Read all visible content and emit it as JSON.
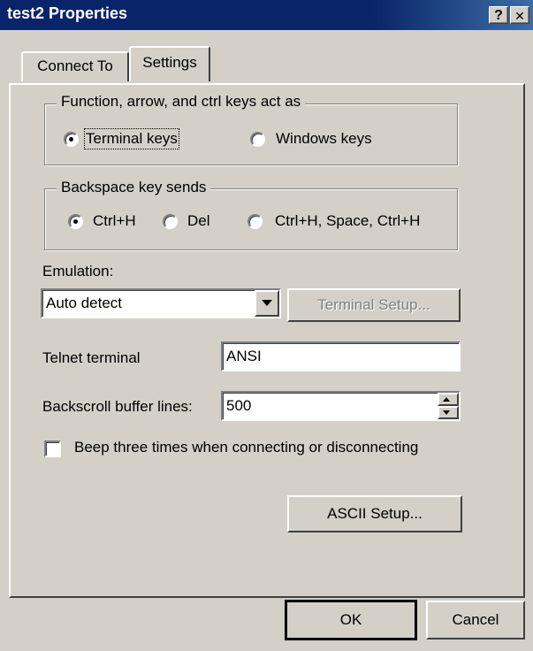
{
  "window": {
    "title": "test2 Properties",
    "help_button": "?",
    "close_button": "✕"
  },
  "tabs": [
    {
      "label": "Connect To",
      "active": false
    },
    {
      "label": "Settings",
      "active": true
    }
  ],
  "function_keys": {
    "legend": "Function, arrow, and ctrl keys act as",
    "options": [
      {
        "label": "Terminal keys",
        "selected": true
      },
      {
        "label": "Windows keys",
        "selected": false
      }
    ]
  },
  "backspace": {
    "legend": "Backspace key sends",
    "options": [
      {
        "label": "Ctrl+H",
        "selected": true
      },
      {
        "label": "Del",
        "selected": false
      },
      {
        "label": "Ctrl+H, Space, Ctrl+H",
        "selected": false
      }
    ]
  },
  "emulation": {
    "label": "Emulation:",
    "value": "Auto detect",
    "terminal_setup_button": "Terminal Setup..."
  },
  "telnet": {
    "label": "Telnet terminal",
    "value": "ANSI"
  },
  "backscroll": {
    "label": "Backscroll buffer lines:",
    "value": "500"
  },
  "beep": {
    "label": "Beep three times when connecting or disconnecting",
    "checked": false
  },
  "ascii_setup_button": "ASCII Setup...",
  "footer": {
    "ok": "OK",
    "cancel": "Cancel"
  }
}
